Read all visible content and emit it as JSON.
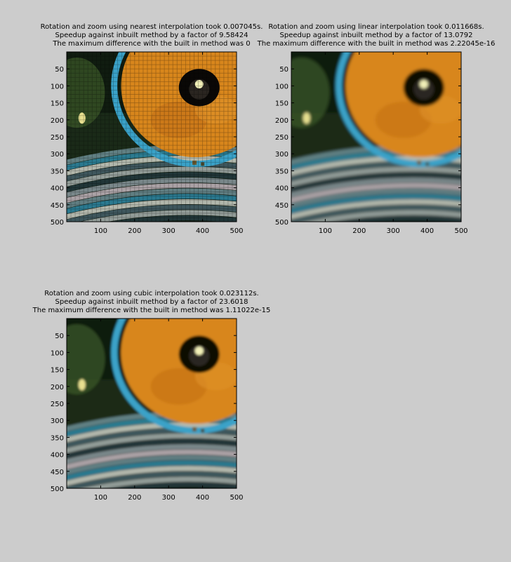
{
  "chart_data": [
    {
      "type": "image",
      "id": "nearest",
      "title": [
        "Rotation and zoom using nearest interpolation took 0.007045s.",
        "Speedup against inbuilt method by a factor of 9.58424",
        "The maximum difference with the built in method was 0"
      ],
      "x_ticks": [
        100,
        200,
        300,
        400,
        500
      ],
      "y_ticks": [
        50,
        100,
        150,
        200,
        250,
        300,
        350,
        400,
        450,
        500
      ],
      "xlim": [
        0,
        500
      ],
      "ylim": [
        0,
        500
      ],
      "style": "pixelated"
    },
    {
      "type": "image",
      "id": "linear",
      "title": [
        "Rotation and zoom using linear interpolation took 0.011668s.",
        "Speedup against inbuilt method by a factor of 13.0792",
        "The maximum difference with the built in method was 2.22045e-16"
      ],
      "x_ticks": [
        100,
        200,
        300,
        400,
        500
      ],
      "y_ticks": [
        50,
        100,
        150,
        200,
        250,
        300,
        350,
        400,
        450,
        500
      ],
      "xlim": [
        0,
        500
      ],
      "ylim": [
        0,
        500
      ],
      "style": "smooth"
    },
    {
      "type": "image",
      "id": "cubic",
      "title": [
        "Rotation and zoom using cubic interpolation took 0.023112s.",
        "Speedup against inbuilt method by a factor of 23.6018",
        "The maximum difference with the built in method was 1.11022e-15"
      ],
      "x_ticks": [
        100,
        200,
        300,
        400,
        500
      ],
      "y_ticks": [
        50,
        100,
        150,
        200,
        250,
        300,
        350,
        400,
        450,
        500
      ],
      "xlim": [
        0,
        500
      ],
      "ylim": [
        0,
        500
      ],
      "style": "smooth"
    }
  ],
  "colors": {
    "background": "#cccccc",
    "dark": "#101c10",
    "iris": "#d8861c",
    "blue_ring": "#3aa2c8",
    "highlight": "#f2f0b8"
  }
}
